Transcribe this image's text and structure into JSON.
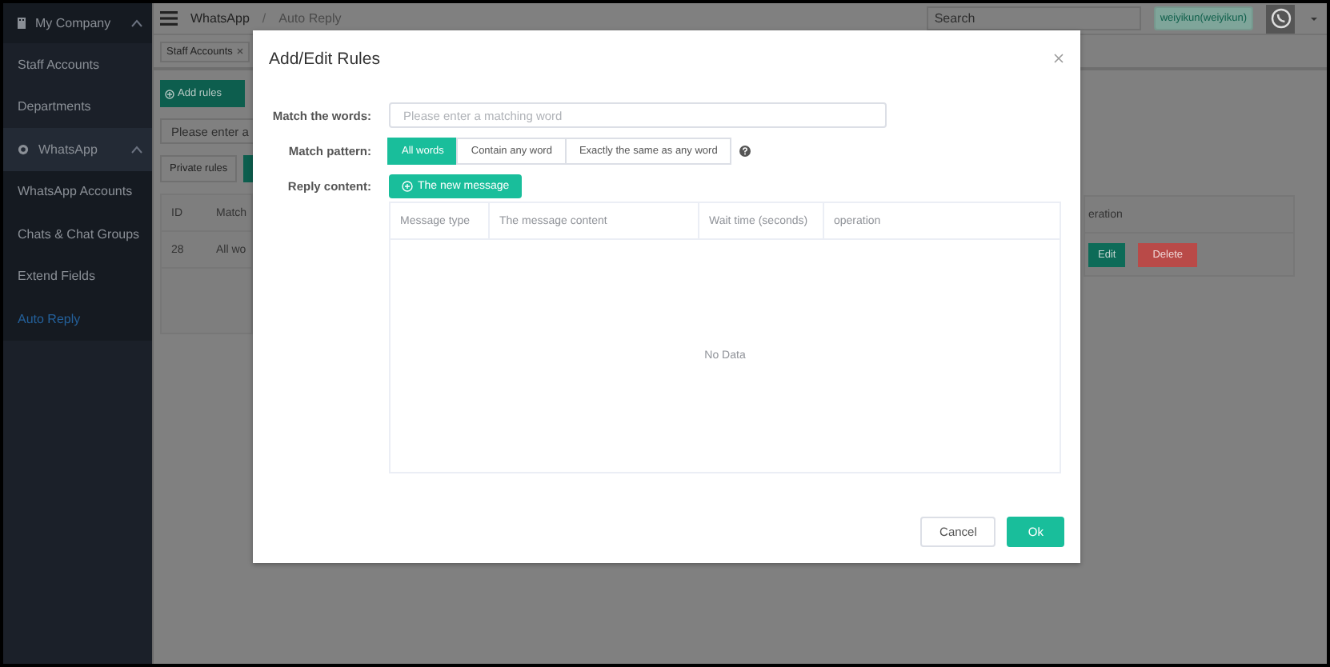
{
  "sidebar": {
    "company": "My Company",
    "company_expanded": true,
    "items": [
      {
        "kind": "link",
        "label": "Staff Accounts",
        "selected": false
      },
      {
        "kind": "link",
        "label": "Departments",
        "selected": false
      },
      {
        "kind": "group",
        "label": "WhatsApp",
        "expanded": true,
        "children": [
          {
            "kind": "link",
            "label": "WhatsApp Accounts",
            "selected": false
          },
          {
            "kind": "link",
            "label": "Chats & Chat Groups",
            "selected": false
          },
          {
            "kind": "link",
            "label": "Extend Fields",
            "selected": false
          },
          {
            "kind": "link",
            "label": "Auto Reply",
            "selected": true
          }
        ]
      }
    ]
  },
  "header": {
    "breadcrumb": [
      "WhatsApp",
      "Auto Reply"
    ],
    "separator": "/",
    "search": {
      "placeholder": "Search"
    },
    "user": "weiyikun(weiyikun)"
  },
  "tabs": [
    {
      "label": "Staff Accounts"
    }
  ],
  "page": {
    "add_button": "Add rules",
    "search": {
      "placeholder": "Please enter a"
    },
    "filter_tabs": [
      {
        "label": "Private rules",
        "selected": false
      }
    ],
    "table": {
      "columns": [
        "ID",
        "Match"
      ],
      "rows": [
        {
          "id": "28",
          "match": "All wo"
        }
      ],
      "right_column": "eration",
      "actions": [
        {
          "kind": "edit",
          "label": "Edit"
        },
        {
          "kind": "delete",
          "label": "Delete"
        }
      ]
    }
  },
  "modal": {
    "title": "Add/Edit Rules",
    "match_words": {
      "label": "Match the words:",
      "placeholder": "Please enter a matching word"
    },
    "match_pattern": {
      "label": "Match pattern:",
      "options": [
        {
          "label": "All words",
          "selected": true
        },
        {
          "label": "Contain any word",
          "selected": false
        },
        {
          "label": "Exactly the same as any word",
          "selected": false
        }
      ]
    },
    "reply_content": {
      "label": "Reply content:",
      "button": "The new message"
    },
    "table": {
      "columns": [
        "Message type",
        "The message content",
        "Wait time (seconds)",
        "operation"
      ],
      "empty": "No Data"
    },
    "buttons": [
      {
        "kind": "cancel",
        "label": "Cancel"
      },
      {
        "kind": "ok",
        "label": "Ok"
      }
    ]
  }
}
